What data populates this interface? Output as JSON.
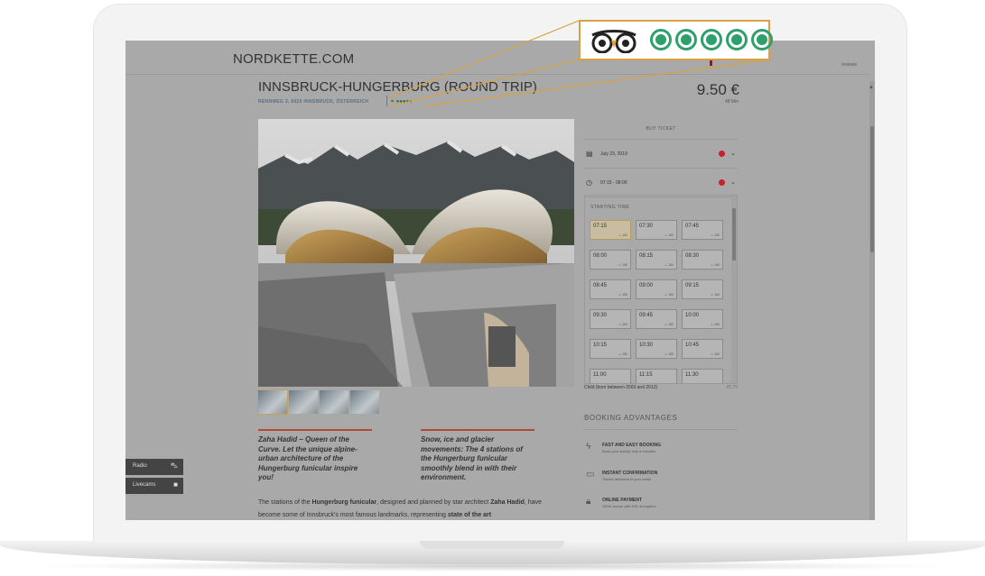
{
  "header": {
    "site_title": "NORDKETTE.COM",
    "top_right": "reviews"
  },
  "product": {
    "title": "INNSBRUCK-HUNGERBURG (ROUND TRIP)",
    "address": "RENNWEG 3, 6020 INNSBRUCK, ÖSTERREICH",
    "price": "9.50 €",
    "price_sub": "48 Min"
  },
  "booking": {
    "buy_ticket": "BUY TICKET",
    "date": "July 23, 2019",
    "time_range": "07:15 - 08:00",
    "starting_label": "STARTING TIME",
    "slots": [
      {
        "time": "07:15",
        "seats": "⊥ 150"
      },
      {
        "time": "07:30",
        "seats": "⊥ 150"
      },
      {
        "time": "07:45",
        "seats": "⊥ 150"
      },
      {
        "time": "08:00",
        "seats": "⊥ 150"
      },
      {
        "time": "08:15",
        "seats": "⊥ 150"
      },
      {
        "time": "08:30",
        "seats": "⊥ 150"
      },
      {
        "time": "08:45",
        "seats": "⊥ 150"
      },
      {
        "time": "09:00",
        "seats": "⊥ 150"
      },
      {
        "time": "09:15",
        "seats": "⊥ 150"
      },
      {
        "time": "09:30",
        "seats": "⊥ 150"
      },
      {
        "time": "09:45",
        "seats": "⊥ 150"
      },
      {
        "time": "10:00",
        "seats": "⊥ 150"
      },
      {
        "time": "10:15",
        "seats": "⊥ 150"
      },
      {
        "time": "10:30",
        "seats": "⊥ 150"
      },
      {
        "time": "10:45",
        "seats": "⊥ 150"
      },
      {
        "time": "11:00",
        "seats": ""
      },
      {
        "time": "11:15",
        "seats": ""
      },
      {
        "time": "11:30",
        "seats": ""
      }
    ],
    "child_label": "Child (born between 2003 and 2012)",
    "child_price": "€5.70"
  },
  "advantages": {
    "title": "BOOKING ADVANTAGES",
    "items": [
      {
        "icon": "lightning-icon",
        "title": "FAST AND EASY BOOKING",
        "sub": "Book your activity only in minutes"
      },
      {
        "icon": "ticket-icon",
        "title": "INSTANT CONFIRMATION",
        "sub": "Tickets delivered to your email"
      },
      {
        "icon": "lock-icon",
        "title": "ONLINE PAYMENT",
        "sub": "100% secure with SSL encryption"
      }
    ]
  },
  "quotes": {
    "q1": "Zaha Hadid – Queen of the Curve. Let the unique alpine-urban architecture of the Hungerburg funicular inspire you!",
    "q2": "Snow, ice and glacier movements: The 4 stations of the Hungerburg funicular smoothly blend in with their environment."
  },
  "body": {
    "p1_a": "The stations of the ",
    "p1_b": "Hungerburg funicular",
    "p1_c": ", designed and planned by star architect ",
    "p1_d": "Zaha Hadid",
    "p1_e": ", have become some of Innsbruck's most famous landmarks, representing ",
    "p1_f": "state of the art"
  },
  "side_buttons": {
    "radio": "Radio",
    "livecams": "Livecams"
  },
  "colors": {
    "callout_border": "#d8a242",
    "ta_green": "#2fa06b",
    "quote_accent": "#b0493a",
    "dot_red": "#c8202a"
  },
  "tripadvisor": {
    "rating": 5,
    "max": 5
  }
}
